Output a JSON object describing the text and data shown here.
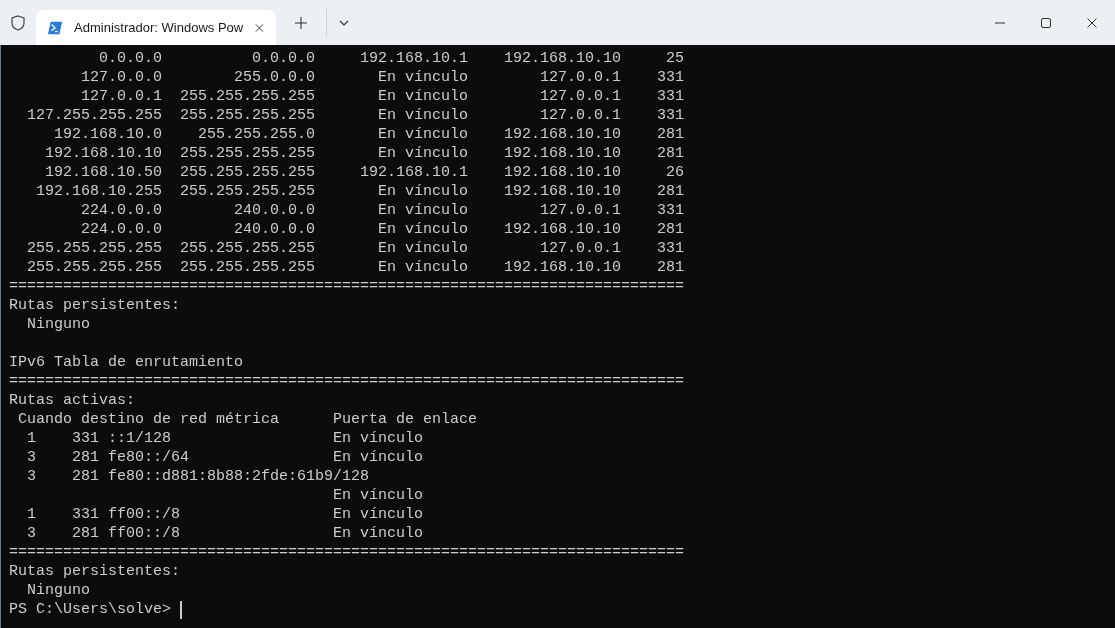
{
  "window": {
    "tabs": [
      {
        "title": "Administrador: Windows Pow",
        "selected": true
      }
    ]
  },
  "terminal": {
    "lines": [
      {
        "kind": "text",
        "text": "          0.0.0.0          0.0.0.0     192.168.10.1    192.168.10.10     25"
      },
      {
        "kind": "text",
        "text": "        127.0.0.0        255.0.0.0       En vínculo        127.0.0.1    331"
      },
      {
        "kind": "text",
        "text": "        127.0.0.1  255.255.255.255       En vínculo        127.0.0.1    331"
      },
      {
        "kind": "text",
        "text": "  127.255.255.255  255.255.255.255       En vínculo        127.0.0.1    331"
      },
      {
        "kind": "text",
        "text": "     192.168.10.0    255.255.255.0       En vínculo    192.168.10.10    281"
      },
      {
        "kind": "text",
        "text": "    192.168.10.10  255.255.255.255       En vínculo    192.168.10.10    281"
      },
      {
        "kind": "text",
        "text": "    192.168.10.50  255.255.255.255     192.168.10.1    192.168.10.10     26"
      },
      {
        "kind": "text",
        "text": "   192.168.10.255  255.255.255.255       En vínculo    192.168.10.10    281"
      },
      {
        "kind": "text",
        "text": "        224.0.0.0        240.0.0.0       En vínculo        127.0.0.1    331"
      },
      {
        "kind": "text",
        "text": "        224.0.0.0        240.0.0.0       En vínculo    192.168.10.10    281"
      },
      {
        "kind": "text",
        "text": "  255.255.255.255  255.255.255.255       En vínculo        127.0.0.1    331"
      },
      {
        "kind": "text",
        "text": "  255.255.255.255  255.255.255.255       En vínculo    192.168.10.10    281"
      },
      {
        "kind": "text",
        "text": "==========================================================================="
      },
      {
        "kind": "text",
        "text": "Rutas persistentes:"
      },
      {
        "kind": "text",
        "text": "  Ninguno"
      },
      {
        "kind": "blank"
      },
      {
        "kind": "text",
        "text": "IPv6 Tabla de enrutamiento"
      },
      {
        "kind": "text",
        "text": "==========================================================================="
      },
      {
        "kind": "text",
        "text": "Rutas activas:"
      },
      {
        "kind": "text",
        "text": " Cuando destino de red métrica      Puerta de enlace"
      },
      {
        "kind": "text",
        "text": "  1    331 ::1/128                  En vínculo"
      },
      {
        "kind": "text",
        "text": "  3    281 fe80::/64                En vínculo"
      },
      {
        "kind": "text",
        "text": "  3    281 fe80::d881:8b88:2fde:61b9/128"
      },
      {
        "kind": "text",
        "text": "                                    En vínculo"
      },
      {
        "kind": "text",
        "text": "  1    331 ff00::/8                 En vínculo"
      },
      {
        "kind": "text",
        "text": "  3    281 ff00::/8                 En vínculo"
      },
      {
        "kind": "text",
        "text": "==========================================================================="
      },
      {
        "kind": "text",
        "text": "Rutas persistentes:"
      },
      {
        "kind": "text",
        "text": "  Ninguno"
      },
      {
        "kind": "prompt",
        "text": "PS C:\\Users\\solve> "
      }
    ]
  }
}
